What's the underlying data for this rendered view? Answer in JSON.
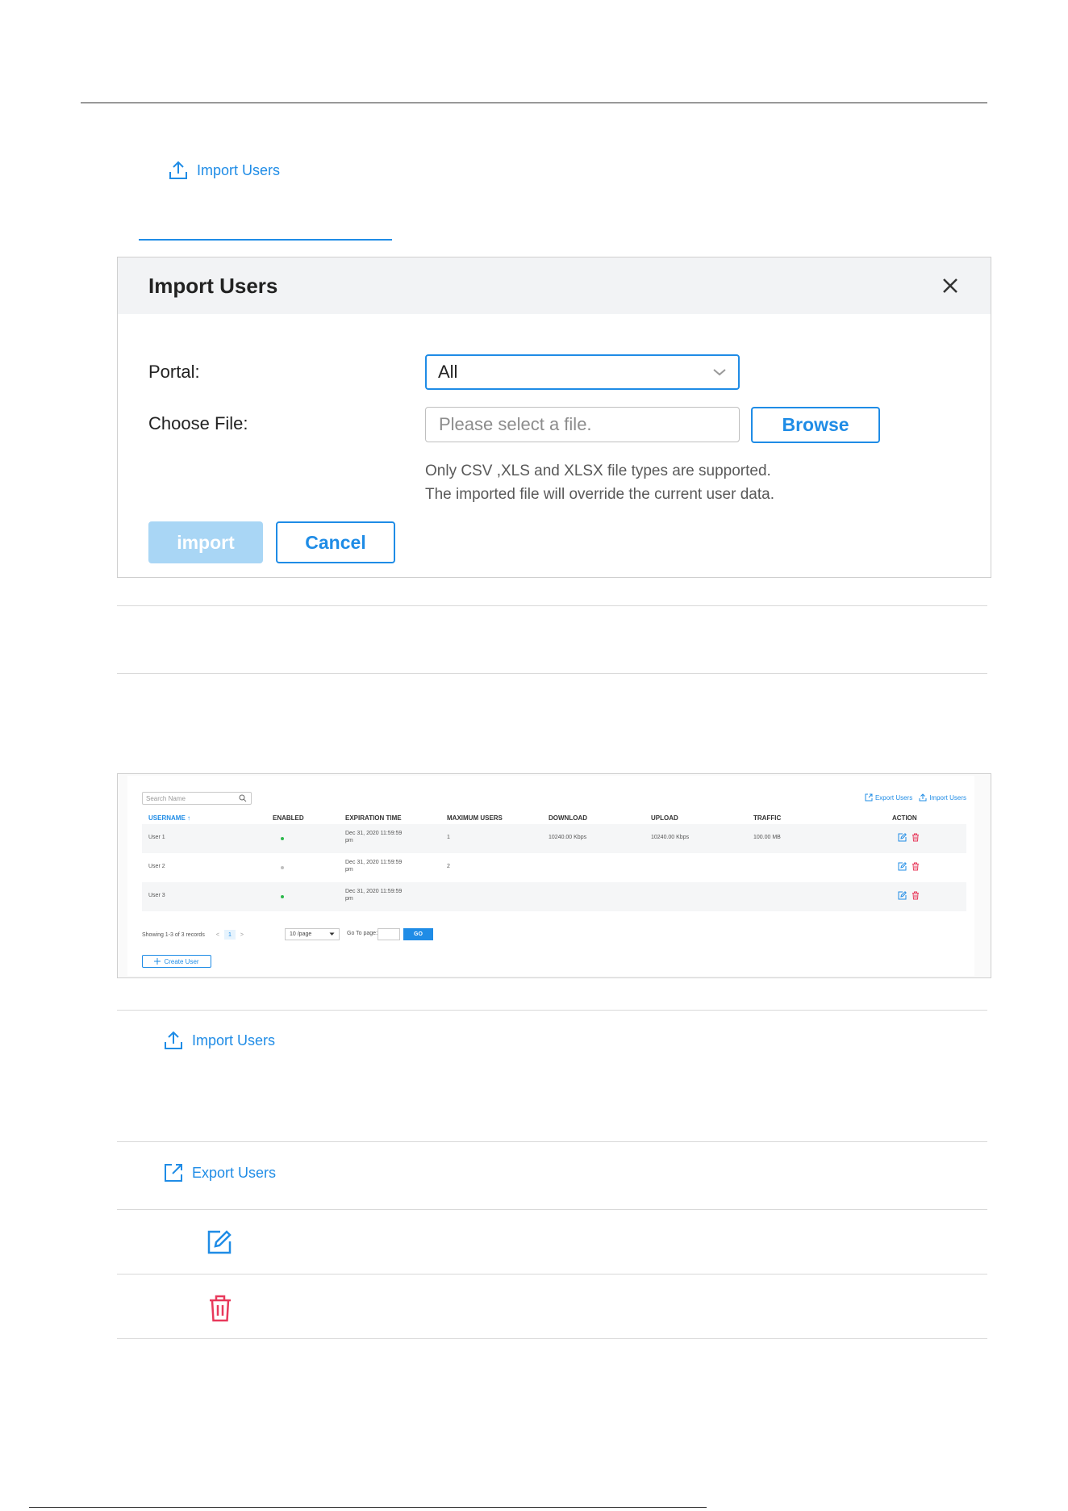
{
  "top_link": {
    "label": "Import Users"
  },
  "dialog": {
    "title": "Import Users",
    "portal_label": "Portal:",
    "portal_value": "All",
    "file_label": "Choose File:",
    "file_placeholder": "Please select a file.",
    "browse_label": "Browse",
    "hint_line1": "Only CSV ,XLS and XLSX file types are supported.",
    "hint_line2": "The imported file will override the current user data.",
    "import_label": "import",
    "cancel_label": "Cancel"
  },
  "table": {
    "search_placeholder": "Search Name",
    "export_label": "Export Users",
    "import_label": "Import Users",
    "headers": {
      "username": "USERNAME ↑",
      "enabled": "ENABLED",
      "expiration": "EXPIRATION TIME",
      "max_users": "MAXIMUM USERS",
      "download": "DOWNLOAD",
      "upload": "UPLOAD",
      "traffic": "TRAFFIC",
      "action": "ACTION"
    },
    "rows": [
      {
        "username": "User 1",
        "enabled_color": "#2db84d",
        "expiration_l1": "Dec 31, 2020 11:59:59",
        "expiration_l2": "pm",
        "max_users": "1",
        "download": "10240.00 Kbps",
        "upload": "10240.00 Kbps",
        "traffic": "100.00 MB"
      },
      {
        "username": "User 2",
        "enabled_color": "#bfbfbf",
        "expiration_l1": "Dec 31, 2020 11:59:59",
        "expiration_l2": "pm",
        "max_users": "2",
        "download": "",
        "upload": "",
        "traffic": ""
      },
      {
        "username": "User 3",
        "enabled_color": "#2db84d",
        "expiration_l1": "Dec 31, 2020 11:59:59",
        "expiration_l2": "pm",
        "max_users": "",
        "download": "",
        "upload": "",
        "traffic": ""
      }
    ],
    "pager": {
      "showing": "Showing 1-3 of 3 records",
      "prev": "<",
      "page": "1",
      "next": ">",
      "per_page": "10 /page",
      "goto_label": "Go To page:",
      "go_label": "GO"
    },
    "create_label": "Create User"
  },
  "legend": {
    "import_label": "Import Users",
    "export_label": "Export Users"
  },
  "colors": {
    "accent": "#1f8ce6",
    "danger": "#e8395b",
    "enabled": "#2db84d"
  }
}
